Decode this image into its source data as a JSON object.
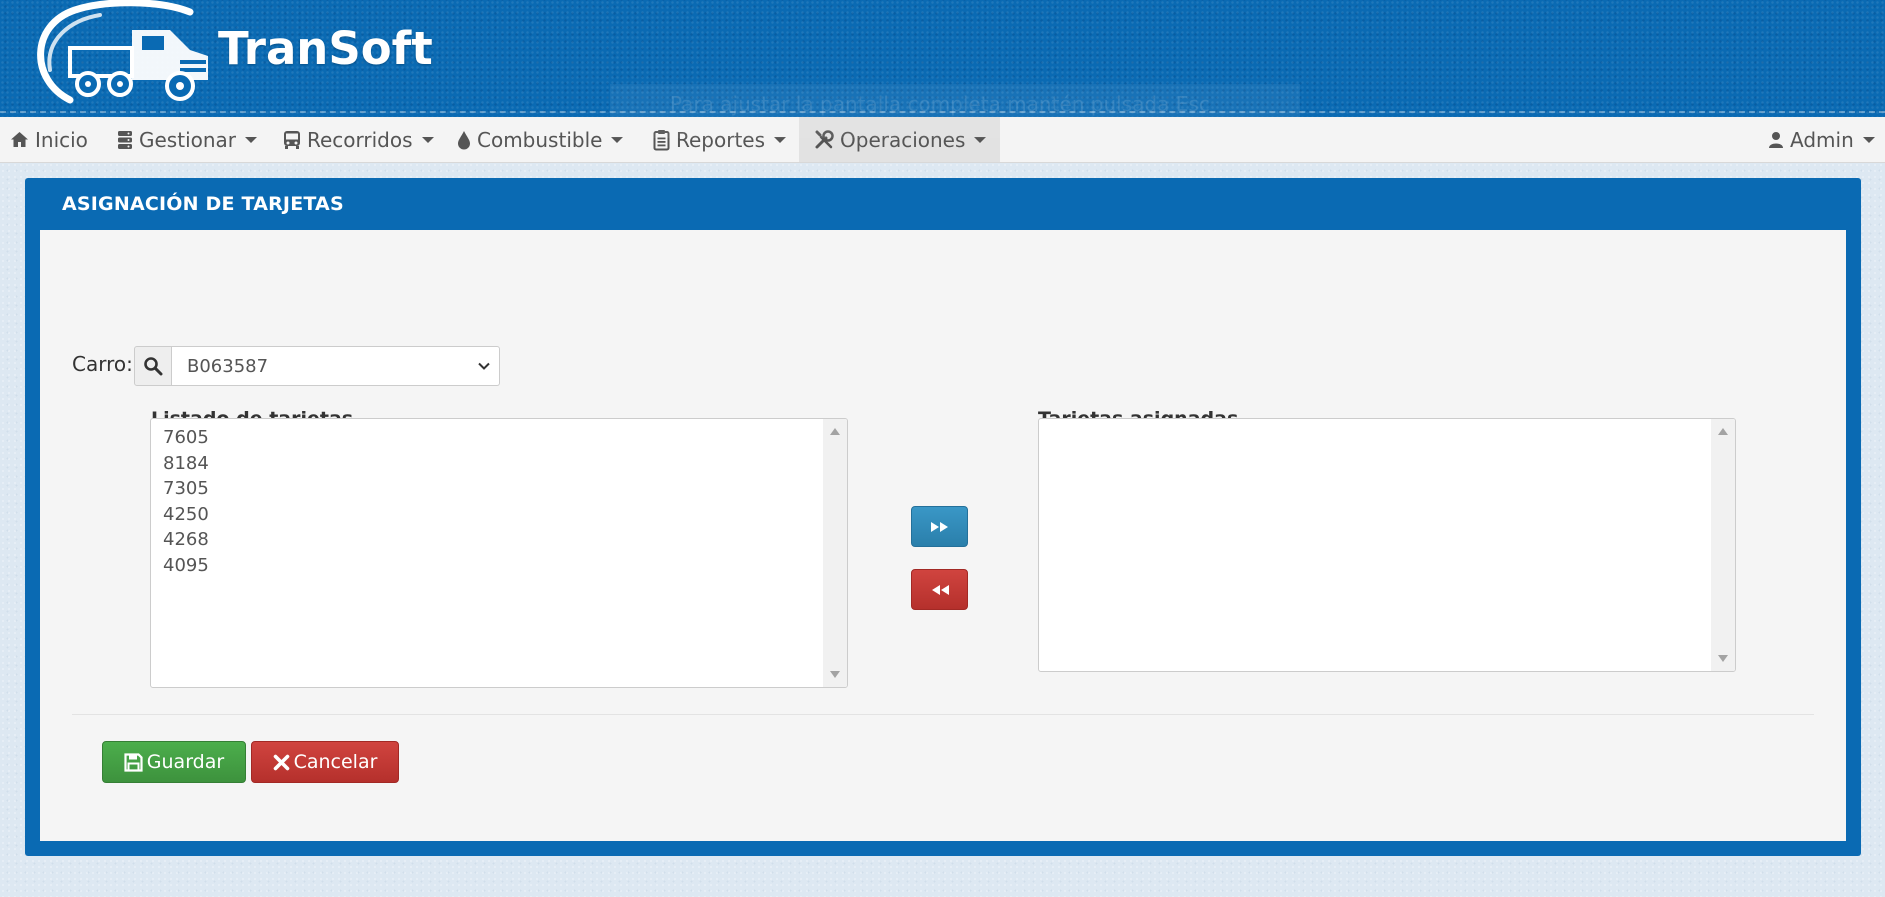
{
  "header": {
    "brand": "TranSoft",
    "toast_text": "Para ajustar la pantalla completa mantén pulsada Esc"
  },
  "nav": {
    "items": [
      {
        "label": "Inicio",
        "icon": "home-icon"
      },
      {
        "label": "Gestionar",
        "icon": "database-icon"
      },
      {
        "label": "Recorridos",
        "icon": "bus-icon"
      },
      {
        "label": "Combustible",
        "icon": "fuel-drop-icon"
      },
      {
        "label": "Reportes",
        "icon": "clipboard-icon"
      },
      {
        "label": "Operaciones",
        "icon": "wrench-screwdriver-icon",
        "active": true
      }
    ],
    "user": {
      "label": "Admin",
      "icon": "user-icon"
    }
  },
  "panel": {
    "title": "ASIGNACIÓN DE TARJETAS"
  },
  "form": {
    "carro_label": "Carro:",
    "carro_value": "B063587"
  },
  "lists": {
    "available_title": "Listado de tarjetas",
    "available_items": [
      "7605",
      "8184",
      "7305",
      "4250",
      "4268",
      "4095"
    ],
    "assigned_title": "Tarjetas asignadas",
    "assigned_items": []
  },
  "buttons": {
    "save_label": "Guardar",
    "cancel_label": "Cancelar"
  },
  "colors": {
    "brand_blue": "#0a6ab3",
    "success_green": "#449d44",
    "danger_red": "#c9302c",
    "info_blue": "#31b0d5"
  }
}
